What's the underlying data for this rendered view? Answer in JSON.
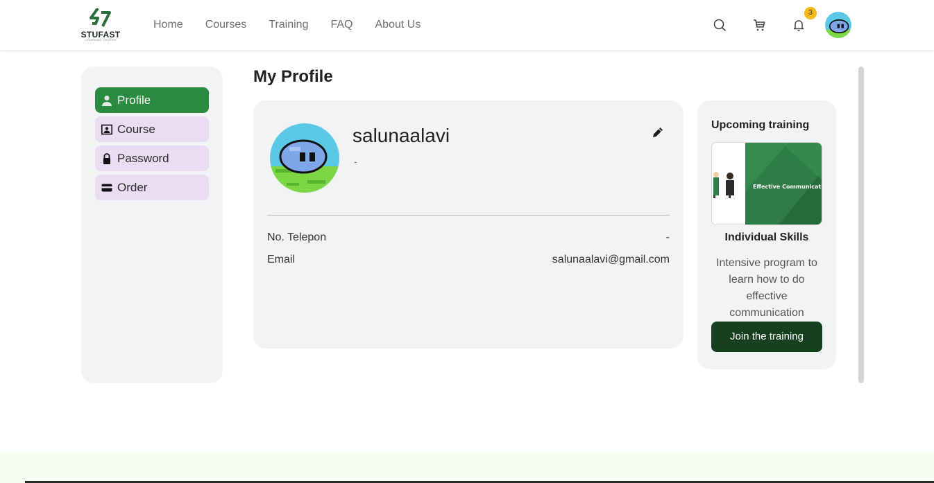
{
  "brand": {
    "name": "STUFAST",
    "tagline": "LEARNING CENTER"
  },
  "nav": {
    "items": [
      "Home",
      "Courses",
      "Training",
      "FAQ",
      "About Us"
    ]
  },
  "header": {
    "notification_count": "3"
  },
  "sidebar": {
    "items": [
      {
        "label": "Profile",
        "icon": "user-icon",
        "active": true
      },
      {
        "label": "Course",
        "icon": "course-icon",
        "active": false
      },
      {
        "label": "Password",
        "icon": "lock-icon",
        "active": false
      },
      {
        "label": "Order",
        "icon": "card-icon",
        "active": false
      }
    ]
  },
  "main": {
    "title": "My Profile",
    "profile": {
      "username": "salunaalavi",
      "subline": "-",
      "phone_label": "No. Telepon",
      "phone_value": "-",
      "email_label": "Email",
      "email_value": "salunaalavi@gmail.com"
    }
  },
  "training": {
    "heading": "Upcoming training",
    "image_text": "Effective Communication",
    "title": "Individual Skills",
    "description": "Intensive program to learn how to do effective communication",
    "button": "Join the training"
  },
  "colors": {
    "accent": "#2a8a3e",
    "dark_button": "#17401f",
    "sidebar_item": "#eadcf3",
    "card_bg": "#f2f3f5",
    "badge": "#f5b81a"
  }
}
